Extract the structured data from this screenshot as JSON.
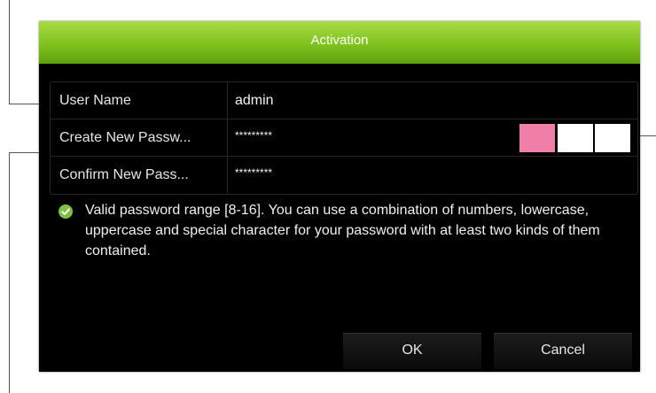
{
  "dialog": {
    "title": "Activation"
  },
  "form": {
    "username_label": "User Name",
    "username_value": "admin",
    "new_password_label": "Create New Passw...",
    "new_password_value": "*********",
    "confirm_password_label": "Confirm New Pass...",
    "confirm_password_value": "*********",
    "strength_colors": [
      "#ef7fa8",
      "#ffffff",
      "#ffffff"
    ]
  },
  "info": {
    "icon": "check-circle-icon",
    "icon_color": "#7cc142",
    "text": "Valid password range [8-16]. You can use a combination of numbers, lowercase, uppercase and special character for your password with at least two kinds of them contained."
  },
  "buttons": {
    "ok_label": "OK",
    "cancel_label": "Cancel"
  },
  "colors": {
    "titlebar": "#7fc21e",
    "background": "#000000"
  }
}
